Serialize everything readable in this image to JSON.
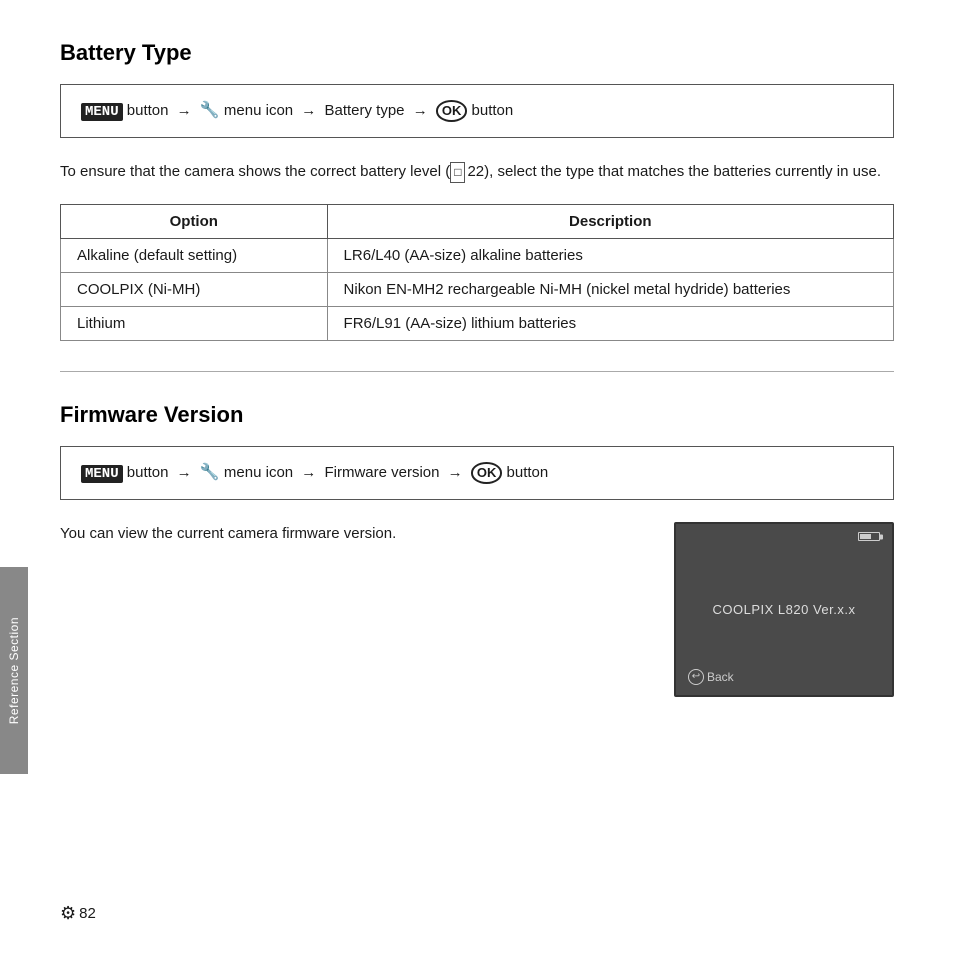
{
  "battery_section": {
    "title": "Battery Type",
    "menu_path": {
      "menu_keyword": "MENU",
      "part1": " button ",
      "arrow1": "→",
      "wrench": "🔧",
      "part2": " menu icon ",
      "arrow2": "→",
      "battery_type": "Battery type",
      "arrow3": "→",
      "ok_label": "OK",
      "part3": " button"
    },
    "description": "To ensure that the camera shows the correct battery level (",
    "ref_page": "22",
    "description2": "), select the type that matches the batteries currently in use.",
    "table": {
      "col1_header": "Option",
      "col2_header": "Description",
      "rows": [
        {
          "option": "Alkaline (default setting)",
          "description": "LR6/L40 (AA-size) alkaline batteries"
        },
        {
          "option": "COOLPIX (Ni-MH)",
          "description": "Nikon EN-MH2 rechargeable Ni-MH (nickel metal hydride) batteries"
        },
        {
          "option": "Lithium",
          "description": "FR6/L91 (AA-size) lithium batteries"
        }
      ]
    }
  },
  "firmware_section": {
    "title": "Firmware Version",
    "menu_path": {
      "menu_keyword": "MENU",
      "part1": " button ",
      "arrow1": "→",
      "wrench": "🔧",
      "part2": " menu icon ",
      "arrow2": "→",
      "firmware_version": "Firmware version",
      "arrow3": "→",
      "ok_label": "OK",
      "part3": " button"
    },
    "description": "You can view the current camera firmware version.",
    "camera_screen": {
      "model_text": "COOLPIX L820 Ver.x.x",
      "back_label": "Back"
    }
  },
  "sidebar": {
    "label": "Reference Section"
  },
  "footer": {
    "page_number": "82"
  }
}
